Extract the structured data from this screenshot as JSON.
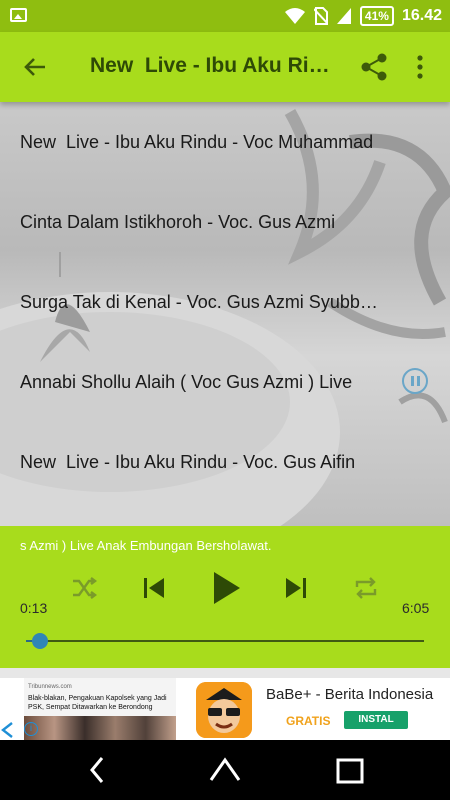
{
  "status_bar": {
    "battery": "41%",
    "time": "16.42"
  },
  "toolbar": {
    "title": "New  Live - Ibu Aku Rindu - Voc Muhammad",
    "back_icon": "arrow-left-icon",
    "share_icon": "share-icon",
    "menu_icon": "more-vert-icon"
  },
  "playlist": {
    "items": [
      {
        "title": "New  Live - Ibu Aku Rindu - Voc Muhammad"
      },
      {
        "title": "Cinta Dalam Istikhoroh - Voc. Gus Azmi"
      },
      {
        "title": "Surga Tak di Kenal - Voc. Gus Azmi Syubbanul Muslimin"
      },
      {
        "title": "Annabi Shollu Alaih ( Voc Gus Azmi ) Live"
      },
      {
        "title": "New  Live - Ibu Aku Rindu - Voc. Gus Aifin"
      }
    ],
    "playing_index": 3
  },
  "player": {
    "now_playing": "s Azmi ) Live Anak Embungan Bersholawat.",
    "elapsed": "0:13",
    "duration": "6:05",
    "progress_fraction": 0.036
  },
  "ad": {
    "thumb_source": "Tribunnews.com",
    "thumb_headline": "Blak-blakan, Pengakuan Kapolsek yang Jadi PSK, Sempat Ditawarkan ke Berondong",
    "app_name": "BaBe+ - Berita Indonesia",
    "price": "GRATIS",
    "install_label": "INSTAL"
  },
  "colors": {
    "accent": "#a8dc1c",
    "status_bar": "#8fbe10",
    "seek_thumb": "#2f86b6"
  }
}
